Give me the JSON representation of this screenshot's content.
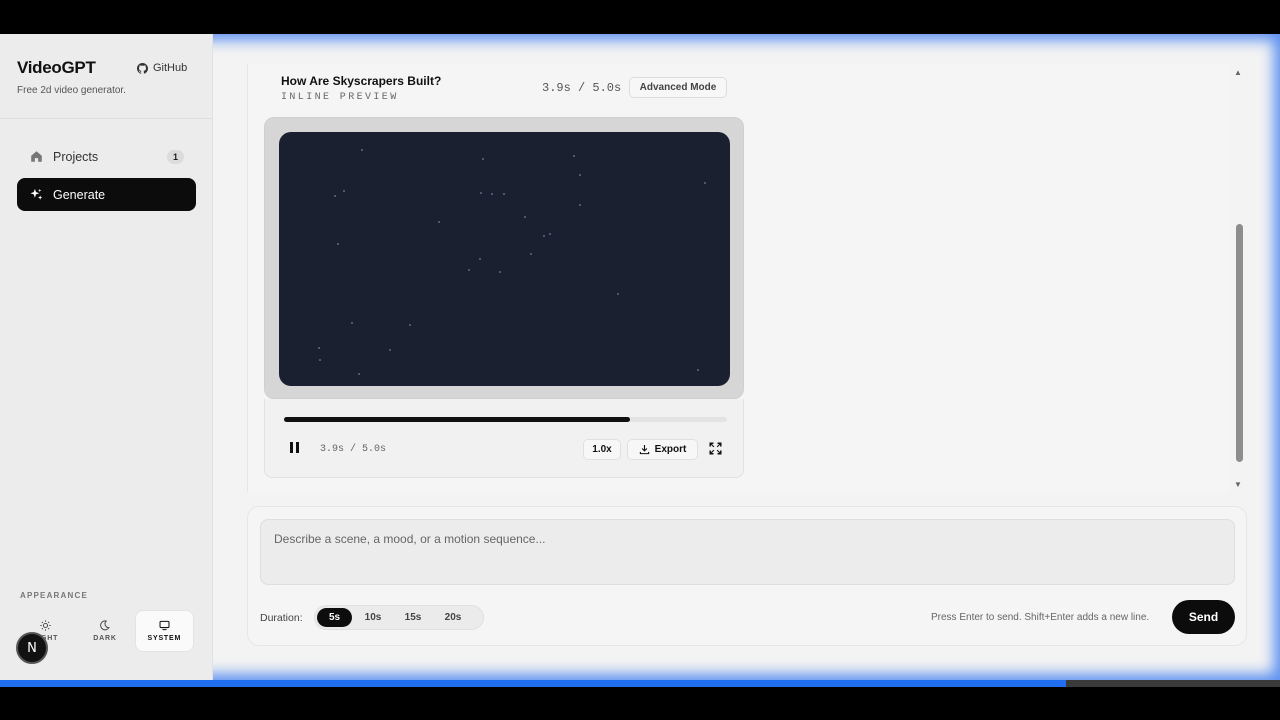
{
  "sidebar": {
    "brand": "VideoGPT",
    "github_label": "GitHub",
    "tagline": "Free 2d video generator.",
    "nav": [
      {
        "label": "Projects",
        "badge": "1",
        "icon": "home-icon"
      },
      {
        "label": "Generate",
        "icon": "sparkles-icon"
      }
    ],
    "appearance_label": "APPEARANCE",
    "themes": [
      {
        "label": "LIGHT",
        "icon": "sun-icon"
      },
      {
        "label": "DARK",
        "icon": "moon-icon"
      },
      {
        "label": "SYSTEM",
        "icon": "monitor-icon"
      }
    ],
    "avatar_letter": "N"
  },
  "preview": {
    "title": "How Are Skyscrapers Built?",
    "subtitle": "INLINE PREVIEW",
    "time": "3.9s / 5.0s",
    "advanced_label": "Advanced Mode",
    "progress_fraction": 0.78,
    "controls": {
      "time": "3.9s / 5.0s",
      "speed": "1.0x",
      "export_label": "Export"
    }
  },
  "composer": {
    "placeholder": "Describe a scene, a mood, or a motion sequence...",
    "duration_label": "Duration:",
    "durations": [
      "5s",
      "10s",
      "15s",
      "20s"
    ],
    "selected_duration": "5s",
    "hint": "Press Enter to send. Shift+Enter adds a new line.",
    "send_label": "Send"
  },
  "colors": {
    "accent": "#0c0c0c",
    "video_bg": "#1a2030",
    "frame_glow": "#5a8ff0",
    "playback_bar": "#1f6ff0"
  },
  "playback_fraction": 0.833
}
